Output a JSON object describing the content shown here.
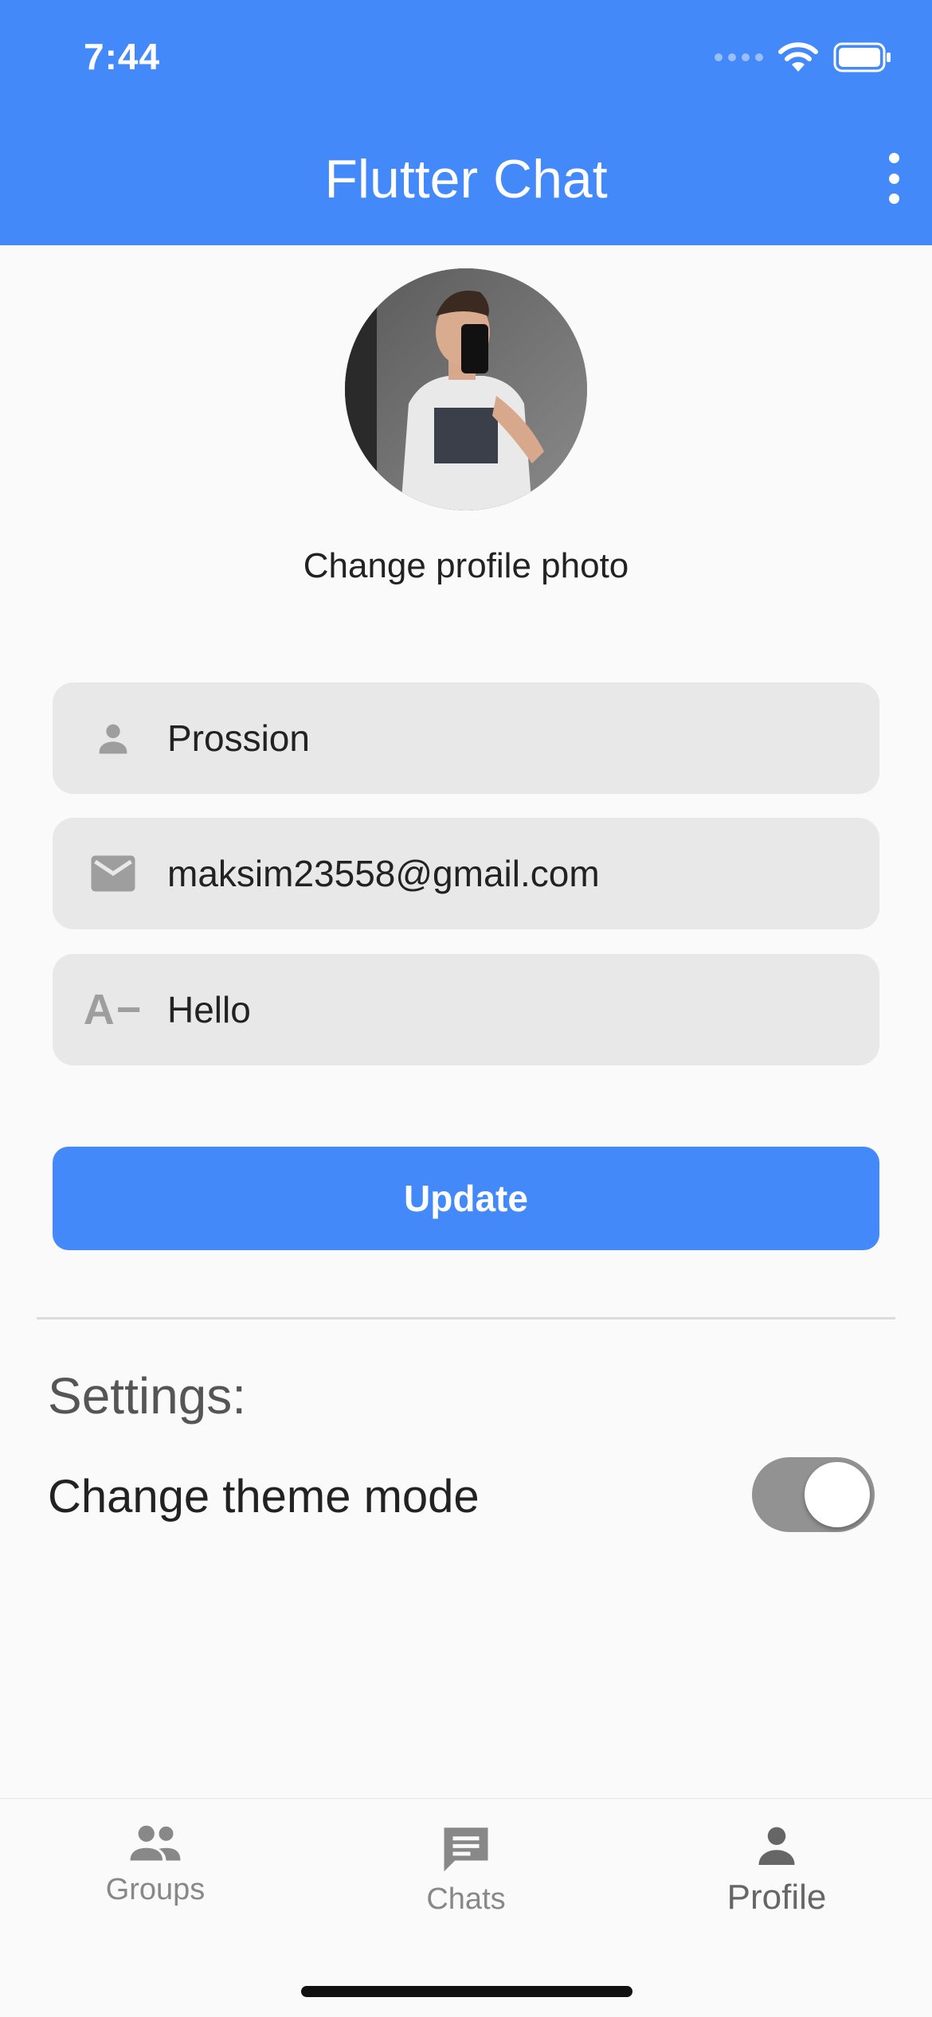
{
  "status": {
    "time": "7:44"
  },
  "appbar": {
    "title": "Flutter Chat",
    "menu_icon": "more-vert-icon"
  },
  "profile": {
    "avatar_alt": "profile-photo",
    "change_photo_label": "Change profile photo"
  },
  "form": {
    "name": {
      "icon": "person-icon",
      "value": "Prossion"
    },
    "email": {
      "icon": "mail-icon",
      "value": "maksim23558@gmail.com"
    },
    "status": {
      "icon": "text-decrease-icon",
      "icon_text": "A−",
      "value": "Hello"
    },
    "update_label": "Update"
  },
  "settings": {
    "title": "Settings:",
    "theme_label": "Change theme mode",
    "theme_toggle_on": true
  },
  "nav": {
    "items": [
      {
        "label": "Groups",
        "icon": "groups-icon",
        "active": false
      },
      {
        "label": "Chats",
        "icon": "chat-icon",
        "active": false
      },
      {
        "label": "Profile",
        "icon": "person-icon",
        "active": true
      }
    ]
  },
  "colors": {
    "primary": "#4489fa",
    "field_bg": "#e8e8e8",
    "icon_grey": "#9e9e9e",
    "toggle_track": "#929292"
  }
}
